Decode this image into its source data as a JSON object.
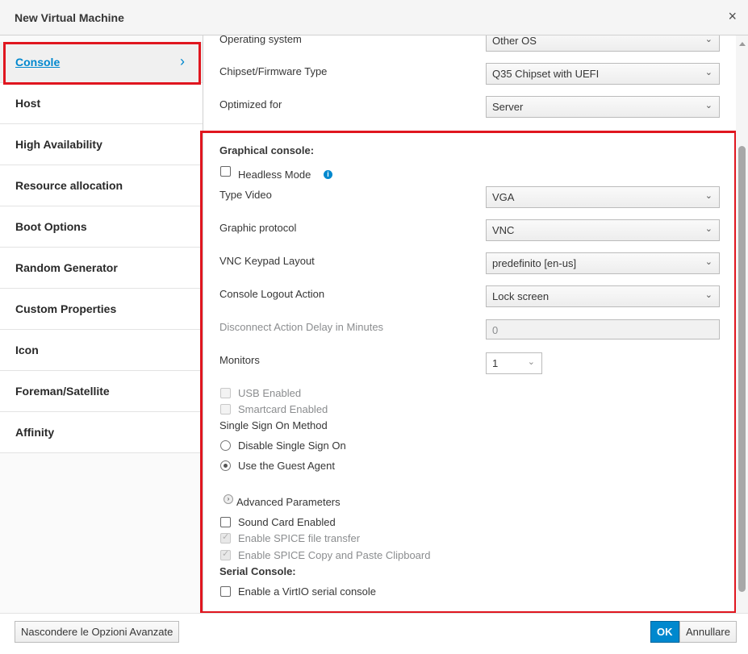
{
  "window": {
    "title": "New Virtual Machine",
    "close_icon": "×"
  },
  "sidebar": {
    "items": [
      {
        "label": "Console",
        "active": true
      },
      {
        "label": "Host"
      },
      {
        "label": "High Availability"
      },
      {
        "label": "Resource allocation"
      },
      {
        "label": "Boot Options"
      },
      {
        "label": "Random Generator"
      },
      {
        "label": "Custom Properties"
      },
      {
        "label": "Icon"
      },
      {
        "label": "Foreman/Satellite"
      },
      {
        "label": "Affinity"
      }
    ],
    "active_chevron": "›"
  },
  "general": {
    "operating_system": {
      "label": "Operating system",
      "value": "Other OS"
    },
    "chipset": {
      "label": "Chipset/Firmware Type",
      "value": "Q35 Chipset with UEFI"
    },
    "optimized_for": {
      "label": "Optimized for",
      "value": "Server"
    }
  },
  "console": {
    "graphical_title": "Graphical console:",
    "headless_mode": {
      "label": "Headless Mode",
      "checked": false
    },
    "video_type": {
      "label": "Type Video",
      "value": "VGA"
    },
    "graphic_protocol": {
      "label": "Graphic protocol",
      "value": "VNC"
    },
    "vnc_keyboard_layout": {
      "label": "VNC Keypad Layout",
      "value": "predefinito [en-us]"
    },
    "logout_action": {
      "label": "Console Logout Action",
      "value": "Lock screen"
    },
    "disconnect_delay": {
      "label": "Disconnect Action Delay in Minutes",
      "value": "0"
    },
    "monitors": {
      "label": "Monitors",
      "value": "1"
    },
    "usb_enabled": {
      "label": "USB Enabled",
      "checked": false
    },
    "smartcard_enabled": {
      "label": "Smartcard Enabled",
      "checked": false
    },
    "sso_title": "Single Sign On Method",
    "sso_disable": {
      "label": "Disable Single Sign On",
      "selected": false
    },
    "sso_guest_agent": {
      "label": "Use the Guest Agent",
      "selected": true
    },
    "advanced_parameters": "Advanced Parameters",
    "sound_card": {
      "label": "Sound Card Enabled",
      "checked": false
    },
    "spice_file_transfer": {
      "label": "Enable SPICE file transfer",
      "checked": true
    },
    "spice_clipboard": {
      "label": "Enable SPICE Copy and Paste Clipboard",
      "checked": true
    },
    "serial_title": "Serial Console:",
    "virtio_serial": {
      "label": "Enable a VirtIO serial console",
      "checked": false
    }
  },
  "footer": {
    "hide_advanced": "Nascondere le Opzioni Avanzate",
    "ok": "OK",
    "cancel": "Annullare"
  },
  "icons": {
    "caret": "⌄",
    "info": "i",
    "expand": "›"
  },
  "colors": {
    "accent": "#0088ce",
    "highlight": "#e0161f",
    "primary_button": "#0088ce"
  }
}
